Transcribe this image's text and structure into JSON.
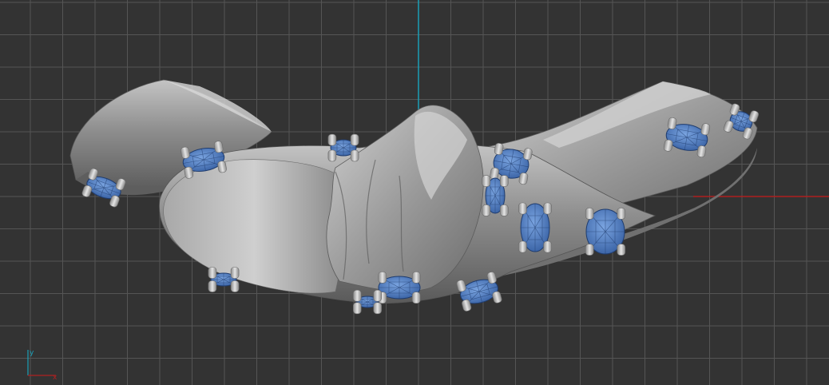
{
  "viewport": {
    "background": "#333333",
    "grid_color": "#4a4a4a",
    "grid_major_color": "#555555"
  },
  "axes": {
    "x_axis_color": "#b02020",
    "y_axis_color": "#1aa0b8",
    "gizmo_x_label": "x",
    "gizmo_y_label": "y"
  },
  "model": {
    "metal_color": "#9a9a9a",
    "gem_color": "#4f7fc4",
    "gem_edge_color": "#1f3c6e",
    "prong_color": "#c9c9c9"
  }
}
